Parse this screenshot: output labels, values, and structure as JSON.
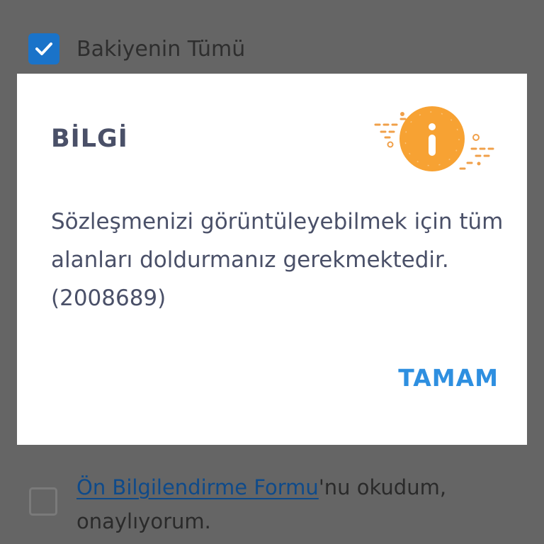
{
  "background": {
    "balance_checkbox": {
      "checked": true,
      "label": "Bakiyenin Tümü"
    },
    "consent_checkbox": {
      "checked": false,
      "link_text": "Ön Bilgilendirme Formu",
      "suffix_text": "'nu okudum, onaylıyorum."
    }
  },
  "dialog": {
    "title": "BİLGİ",
    "message": "Sözleşmenizi görüntüleyebilmek için tüm alanları doldurmanız gerekmektedir.(2008689)",
    "ok_label": "TAMAM",
    "icon": "info-icon"
  },
  "colors": {
    "overlay": "#656565",
    "accent_orange": "#f7a233",
    "button_blue": "#2e8fe0",
    "checkbox_blue": "#1a73c9"
  }
}
